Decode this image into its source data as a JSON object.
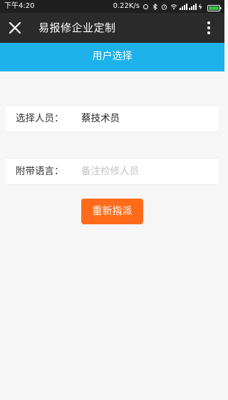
{
  "status_bar": {
    "time": "下午4:20",
    "net_speed": "0.22K/s"
  },
  "titlebar": {
    "title": "易报修企业定制",
    "close_icon": "close-icon",
    "more_icon": "more-vertical-icon"
  },
  "header": {
    "title": "用户选择"
  },
  "form": {
    "person_label": "选择人员：",
    "person_value": "蔡技术员",
    "message_label": "附带语言：",
    "message_placeholder": "备注检修人员",
    "message_value": ""
  },
  "actions": {
    "reassign_label": "重新指派"
  },
  "colors": {
    "header_band": "#1eb2ea",
    "button": "#ff6b1a",
    "titlebar": "#2b2b2b"
  }
}
